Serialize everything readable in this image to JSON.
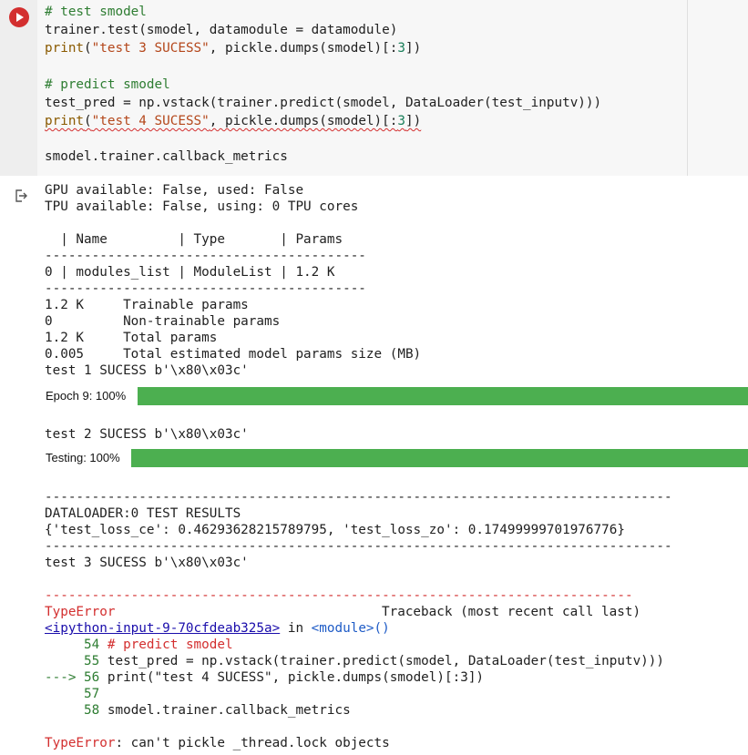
{
  "code": {
    "line1": "# test smodel",
    "line2": "trainer.test(smodel, datamodule = datamodule)",
    "line3_print": "print",
    "line3_open": "(",
    "line3_str": "\"test 3 SUCESS\"",
    "line3_mid": ", pickle.dumps(smodel)[:",
    "line3_num": "3",
    "line3_end": "])",
    "line5": "# predict smodel",
    "line6": "test_pred = np.vstack(trainer.predict(smodel, DataLoader(test_inputv)))",
    "line7_print": "print",
    "line7_open": "(",
    "line7_str": "\"test 4 SUCESS\"",
    "line7_mid": ", pickle.dumps(smodel)[:",
    "line7_num": "3",
    "line7_end": "])",
    "line9": "smodel.trainer.callback_metrics"
  },
  "output": {
    "gpu": "GPU available: False, used: False",
    "tpu": "TPU available: False, using: 0 TPU cores",
    "table_header": "  | Name         | Type       | Params",
    "table_sep1": "-----------------------------------------",
    "table_row": "0 | modules_list | ModuleList | 1.2 K",
    "table_sep2": "-----------------------------------------",
    "params1": "1.2 K     Trainable params",
    "params2": "0         Non-trainable params",
    "params3": "1.2 K     Total params",
    "params4": "0.005     Total estimated model params size (MB)",
    "test1": "test 1 SUCESS b'\\x80\\x03c'",
    "epoch_label": "Epoch 9: 100%",
    "epoch_progress": 1.0,
    "test2": "test 2 SUCESS b'\\x80\\x03c'",
    "testing_label": "Testing: 100%",
    "testing_progress": 1.0,
    "dash_long1": "--------------------------------------------------------------------------------",
    "results_title": "DATALOADER:0 TEST RESULTS",
    "results_dict": "{'test_loss_ce': 0.46293628215789795, 'test_loss_zo': 0.17499999701976776}",
    "dash_long2": "--------------------------------------------------------------------------------",
    "test3": "test 3 SUCESS b'\\x80\\x03c'",
    "err_dash": "---------------------------------------------------------------------------",
    "err_type": "TypeError",
    "traceback_text": "Traceback (most recent call last)",
    "link_text": "<ipython-input-9-70cfdeab325a>",
    "in_text": " in ",
    "module_text": "<module>()",
    "tb_line54_no": "     54",
    "tb_line54": " # predict smodel",
    "tb_line55_no": "     55",
    "tb_line55": " test_pred = np.vstack(trainer.predict(smodel, DataLoader(test_inputv)))",
    "tb_arrow": "---> 56",
    "tb_line56": " print(\"test 4 SUCESS\", pickle.dumps(smodel)[:3])",
    "tb_line57_no": "     57",
    "tb_line58_no": "     58",
    "tb_line58": " smodel.trainer.callback_metrics",
    "final_err_type": "TypeError",
    "final_err_msg": ": can't pickle _thread.lock objects"
  },
  "colors": {
    "run_button": "#d32f2f",
    "progress_fill": "#4caf50",
    "error_red": "#d32f2f"
  },
  "icons": {
    "run": "play-circle-icon",
    "output": "output-redirect-icon"
  }
}
